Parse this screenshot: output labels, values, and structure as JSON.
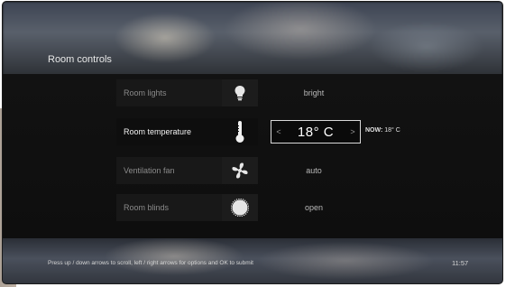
{
  "screen": {
    "title": "Room controls"
  },
  "controls": [
    {
      "label": "Room lights",
      "value": "bright",
      "icon": "lightbulb-icon"
    },
    {
      "label": "Room temperature",
      "value": "18° C",
      "icon": "thermometer-icon"
    },
    {
      "label": "Ventilation fan",
      "value": "auto",
      "icon": "fan-icon"
    },
    {
      "label": "Room blinds",
      "value": "open",
      "icon": "sun-icon"
    }
  ],
  "temperature": {
    "left_arrow": "<",
    "right_arrow": ">",
    "now_label": "NOW:",
    "now_value": "18° C"
  },
  "footer": {
    "hint": "Press up / down arrows to scroll, left / right arrows for options and OK to submit",
    "clock": "11:57"
  },
  "colors": {
    "background": "#0b0b0b",
    "active_text": "#f2f2f2",
    "inactive_text": "#8a8a8a"
  }
}
